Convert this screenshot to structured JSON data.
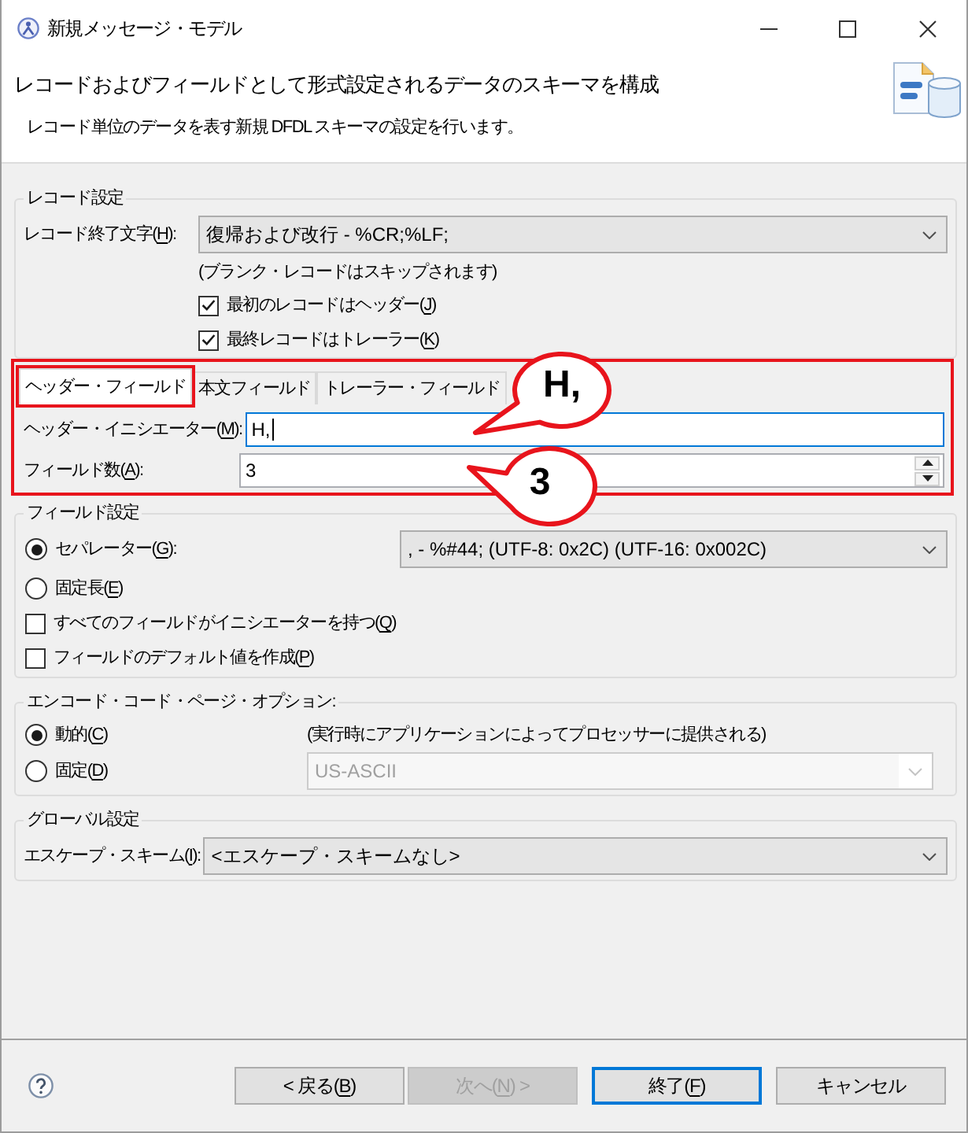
{
  "window": {
    "title": "新規メッセージ・モデル"
  },
  "header": {
    "title": "レコードおよびフィールドとして形式設定されるデータのスキーマを構成",
    "description": "レコード単位のデータを表す新規 DFDL スキーマの設定を行います。"
  },
  "record_settings": {
    "legend": "レコード設定",
    "terminator": {
      "label": "レコード終了文字(H):",
      "underlined_key": true,
      "value": "復帰および改行 - %CR;%LF;"
    },
    "note": "(ブランク・レコードはスキップされます)",
    "checkboxes": [
      {
        "label": "最初のレコードはヘッダー(J)",
        "underlined_key": true,
        "checked": true
      },
      {
        "label": "最終レコードはトレーラー(K)",
        "underlined_key": true,
        "checked": true
      }
    ]
  },
  "field_tabs": {
    "highlighted": true,
    "tabs": [
      {
        "label": "ヘッダー・フィールド",
        "selected": true,
        "highlighted": true
      },
      {
        "label": "本文フィールド",
        "selected": false,
        "highlighted": false
      },
      {
        "label": "トレーラー・フィールド",
        "selected": false,
        "highlighted": false
      }
    ],
    "fields": [
      {
        "kind": "text",
        "label": "ヘッダー・イニシエーター(M):",
        "underlined_key": true,
        "value": "H,",
        "focused": true
      },
      {
        "kind": "spinner",
        "label": "フィールド数(A):",
        "underlined_key": true,
        "value": "3",
        "focused": false
      }
    ]
  },
  "field_settings": {
    "legend": "フィールド設定",
    "options": [
      {
        "kind": "radio",
        "label": "セパレーター(G):",
        "underlined_key": true,
        "selected": true
      },
      {
        "kind": "radio",
        "label": "固定長(E)",
        "underlined_key": true,
        "selected": false
      },
      {
        "kind": "checkbox",
        "label": "すべてのフィールドがイニシエーターを持つ(Q)",
        "underlined_key": true,
        "checked": false
      },
      {
        "kind": "checkbox",
        "label": "フィールドのデフォルト値を作成(P)",
        "underlined_key": true,
        "checked": false
      }
    ],
    "separator": {
      "value": ", - %#44; (UTF-8: 0x2C) (UTF-16: 0x002C)"
    }
  },
  "encoding": {
    "legend": "エンコード・コード・ページ・オプション:",
    "options": [
      {
        "label": "動的(C)",
        "underlined_key": true,
        "selected": true
      },
      {
        "label": "固定(D)",
        "underlined_key": true,
        "selected": false
      }
    ],
    "note": "(実行時にアプリケーションによってプロセッサーに提供される)",
    "code_page": {
      "value": "US-ASCII",
      "disabled": true
    }
  },
  "global_settings": {
    "legend": "グローバル設定",
    "escape_scheme": {
      "label": "エスケープ・スキーム(I):",
      "underlined_key": true,
      "value": "<エスケープ・スキームなし>"
    }
  },
  "buttons": [
    {
      "label": "< 戻る(B)",
      "underlined_key": true,
      "disabled": false,
      "default": false
    },
    {
      "label": "次へ(N) >",
      "underlined_key": true,
      "disabled": true,
      "default": false
    },
    {
      "label": "終了(F)",
      "underlined_key": true,
      "disabled": false,
      "default": true
    },
    {
      "label": "キャンセル",
      "disabled": false,
      "default": false
    }
  ],
  "callouts": [
    {
      "text": "H,"
    },
    {
      "text": "3"
    }
  ]
}
